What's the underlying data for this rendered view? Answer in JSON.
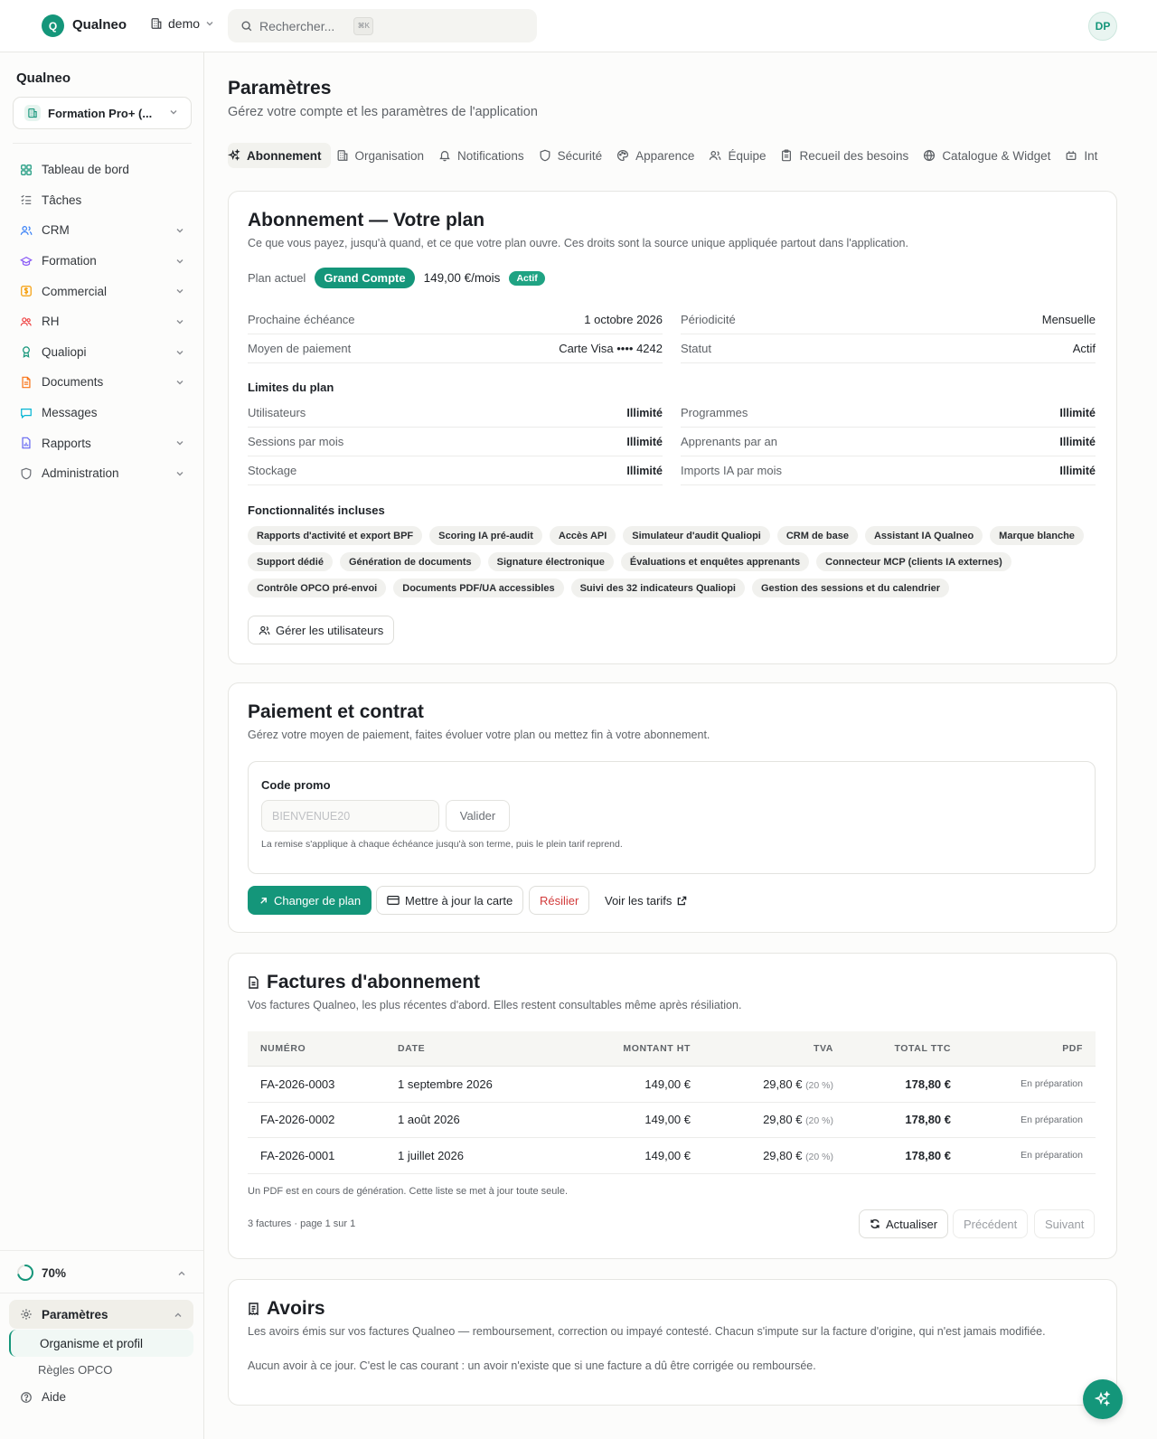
{
  "topbar": {
    "logo_letter": "Q",
    "brand": "Qualneo",
    "workspace": "demo",
    "search_placeholder": "Rechercher...",
    "search_shortcut": "⌘K",
    "avatar_initials": "DP"
  },
  "sidebar": {
    "title": "Qualneo",
    "org_selector": "Formation Pro+ (...",
    "items": [
      {
        "label": "Tableau de bord",
        "icon": "dashboard-icon",
        "color": "#14967a",
        "expandable": false
      },
      {
        "label": "Tâches",
        "icon": "tasks-icon",
        "color": "#6b6f75",
        "expandable": false
      },
      {
        "label": "CRM",
        "icon": "users-icon",
        "color": "#3b82f6",
        "expandable": true
      },
      {
        "label": "Formation",
        "icon": "graduation-icon",
        "color": "#8b5cf6",
        "expandable": true
      },
      {
        "label": "Commercial",
        "icon": "dollar-icon",
        "color": "#f59e0b",
        "expandable": true
      },
      {
        "label": "RH",
        "icon": "people-icon",
        "color": "#ef4444",
        "expandable": true
      },
      {
        "label": "Qualiopi",
        "icon": "award-icon",
        "color": "#14967a",
        "expandable": true
      },
      {
        "label": "Documents",
        "icon": "document-icon",
        "color": "#f97316",
        "expandable": true
      },
      {
        "label": "Messages",
        "icon": "message-icon",
        "color": "#06b6d4",
        "expandable": false
      },
      {
        "label": "Rapports",
        "icon": "report-icon",
        "color": "#6366f1",
        "expandable": true
      },
      {
        "label": "Administration",
        "icon": "shield-icon",
        "color": "#6b6f75",
        "expandable": true
      }
    ],
    "progress_label": "70%",
    "progress_value": 0.7,
    "settings_label": "Paramètres",
    "settings_sub_active": "Organisme et profil",
    "settings_sub_item": "Règles OPCO",
    "help_label": "Aide"
  },
  "page": {
    "title": "Paramètres",
    "subtitle": "Gérez votre compte et les paramètres de l'application"
  },
  "tabs": [
    {
      "label": "Abonnement",
      "icon": "sparkles-icon",
      "active": true
    },
    {
      "label": "Organisation",
      "icon": "building-icon",
      "active": false
    },
    {
      "label": "Notifications",
      "icon": "bell-icon",
      "active": false
    },
    {
      "label": "Sécurité",
      "icon": "shield-icon",
      "active": false
    },
    {
      "label": "Apparence",
      "icon": "palette-icon",
      "active": false
    },
    {
      "label": "Équipe",
      "icon": "team-icon",
      "active": false
    },
    {
      "label": "Recueil des besoins",
      "icon": "clipboard-icon",
      "active": false
    },
    {
      "label": "Catalogue & Widget",
      "icon": "globe-icon",
      "active": false
    },
    {
      "label": "Int",
      "icon": "plug-icon",
      "active": false
    }
  ],
  "subscription": {
    "title": "Abonnement — Votre plan",
    "subtitle": "Ce que vous payez, jusqu'à quand, et ce que votre plan ouvre. Ces droits sont la source unique appliquée partout dans l'application.",
    "plan_label": "Plan actuel",
    "plan_name": "Grand Compte",
    "plan_price": "149,00 €/mois",
    "plan_status_badge": "Actif",
    "details": [
      {
        "label": "Prochaine échéance",
        "value": "1 octobre 2026"
      },
      {
        "label": "Périodicité",
        "value": "Mensuelle"
      },
      {
        "label": "Moyen de paiement",
        "value": "Carte Visa •••• 4242"
      },
      {
        "label": "Statut",
        "value": "Actif"
      }
    ],
    "limits_title": "Limites du plan",
    "limits": [
      {
        "label": "Utilisateurs",
        "value": "Illimité"
      },
      {
        "label": "Programmes",
        "value": "Illimité"
      },
      {
        "label": "Sessions par mois",
        "value": "Illimité"
      },
      {
        "label": "Apprenants par an",
        "value": "Illimité"
      },
      {
        "label": "Stockage",
        "value": "Illimité"
      },
      {
        "label": "Imports IA par mois",
        "value": "Illimité"
      }
    ],
    "features_title": "Fonctionnalités incluses",
    "features": [
      "Rapports d'activité et export BPF",
      "Scoring IA pré-audit",
      "Accès API",
      "Simulateur d'audit Qualiopi",
      "CRM de base",
      "Assistant IA Qualneo",
      "Marque blanche",
      "Support dédié",
      "Génération de documents",
      "Signature électronique",
      "Évaluations et enquêtes apprenants",
      "Connecteur MCP (clients IA externes)",
      "Contrôle OPCO pré-envoi",
      "Documents PDF/UA accessibles",
      "Suivi des 32 indicateurs Qualiopi",
      "Gestion des sessions et du calendrier"
    ],
    "manage_users_button": "Gérer les utilisateurs"
  },
  "payment": {
    "title": "Paiement et contrat",
    "subtitle": "Gérez votre moyen de paiement, faites évoluer votre plan ou mettez fin à votre abonnement.",
    "promo_label": "Code promo",
    "promo_placeholder": "BIENVENUE20",
    "promo_button": "Valider",
    "promo_help": "La remise s'applique à chaque échéance jusqu'à son terme, puis le plein tarif reprend.",
    "change_plan_button": "Changer de plan",
    "update_card_button": "Mettre à jour la carte",
    "cancel_button": "Résilier",
    "pricing_link": "Voir les tarifs"
  },
  "invoices": {
    "title": "Factures d'abonnement",
    "subtitle": "Vos factures Qualneo, les plus récentes d'abord. Elles restent consultables même après résiliation.",
    "columns": [
      "NUMÉRO",
      "DATE",
      "MONTANT HT",
      "TVA",
      "TOTAL TTC",
      "PDF"
    ],
    "rows": [
      {
        "number": "FA-2026-0003",
        "date": "1 septembre 2026",
        "ht": "149,00 €",
        "tva": "29,80 €",
        "rate": "(20 %)",
        "ttc": "178,80 €",
        "pdf": "En préparation"
      },
      {
        "number": "FA-2026-0002",
        "date": "1 août 2026",
        "ht": "149,00 €",
        "tva": "29,80 €",
        "rate": "(20 %)",
        "ttc": "178,80 €",
        "pdf": "En préparation"
      },
      {
        "number": "FA-2026-0001",
        "date": "1 juillet 2026",
        "ht": "149,00 €",
        "tva": "29,80 €",
        "rate": "(20 %)",
        "ttc": "178,80 €",
        "pdf": "En préparation"
      }
    ],
    "note": "Un PDF est en cours de génération. Cette liste se met à jour toute seule.",
    "pagination": "3 factures · page 1 sur 1",
    "refresh_button": "Actualiser",
    "prev_button": "Précédent",
    "next_button": "Suivant"
  },
  "credits": {
    "title": "Avoirs",
    "subtitle": "Les avoirs émis sur vos factures Qualneo — remboursement, correction ou impayé contesté. Chacun s'impute sur la facture d'origine, qui n'est jamais modifiée.",
    "empty": "Aucun avoir à ce jour. C'est le cas courant : un avoir n'existe que si une facture a dû être corrigée ou remboursée."
  },
  "colors": {
    "accent": "#14967a",
    "danger": "#d23b3b"
  }
}
